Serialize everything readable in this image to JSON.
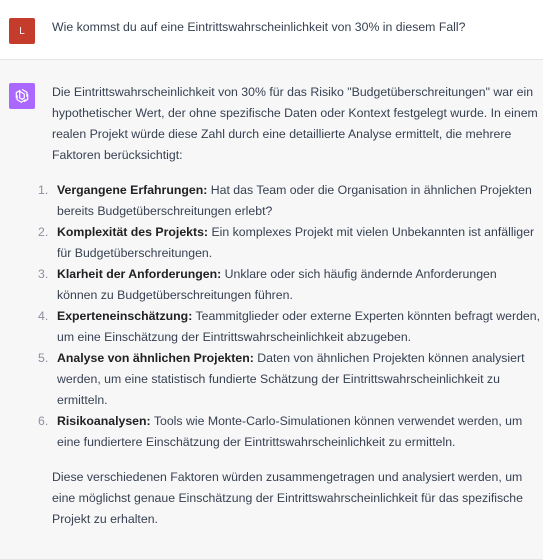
{
  "user_turn": {
    "avatar_letter": "L",
    "message": "Wie kommst du auf eine Eintrittswahrscheinlichkeit von 30% in diesem Fall?"
  },
  "assistant_turn": {
    "avatar_icon": "openai-logo-icon",
    "intro": "Die Eintrittswahrscheinlichkeit von 30% für das Risiko \"Budgetüberschreitungen\" war ein hypothetischer Wert, der ohne spezifische Daten oder Kontext festgelegt wurde. In einem realen Projekt würde diese Zahl durch eine detaillierte Analyse ermittelt, die mehrere Faktoren berücksichtigt:",
    "items": [
      {
        "number": "1.",
        "title": "Vergangene Erfahrungen:",
        "text": " Hat das Team oder die Organisation in ähnlichen Projekten bereits Budgetüberschreitungen erlebt?"
      },
      {
        "number": "2.",
        "title": "Komplexität des Projekts:",
        "text": " Ein komplexes Projekt mit vielen Unbekannten ist anfälliger für Budgetüberschreitungen."
      },
      {
        "number": "3.",
        "title": "Klarheit der Anforderungen:",
        "text": " Unklare oder sich häufig ändernde Anforderungen können zu Budgetüberschreitungen führen."
      },
      {
        "number": "4.",
        "title": "Experteneinschätzung:",
        "text": " Teammitglieder oder externe Experten könnten befragt werden, um eine Einschätzung der Eintrittswahrscheinlichkeit abzugeben."
      },
      {
        "number": "5.",
        "title": "Analyse von ähnlichen Projekten:",
        "text": " Daten von ähnlichen Projekten können analysiert werden, um eine statistisch fundierte Schätzung der Eintrittswahrscheinlichkeit zu ermitteln."
      },
      {
        "number": "6.",
        "title": "Risikoanalysen:",
        "text": " Tools wie Monte-Carlo-Simulationen können verwendet werden, um eine fundiertere Einschätzung der Eintrittswahrscheinlichkeit zu ermitteln."
      }
    ],
    "outro": "Diese verschiedenen Faktoren würden zusammengetragen und analysiert werden, um eine möglichst genaue Einschätzung der Eintrittswahrscheinlichkeit für das spezifische Projekt zu erhalten."
  },
  "colors": {
    "user_avatar": "#c53b2c",
    "assistant_avatar": "#ab68ff",
    "assistant_background": "#f7f7f8",
    "text": "#374151"
  }
}
